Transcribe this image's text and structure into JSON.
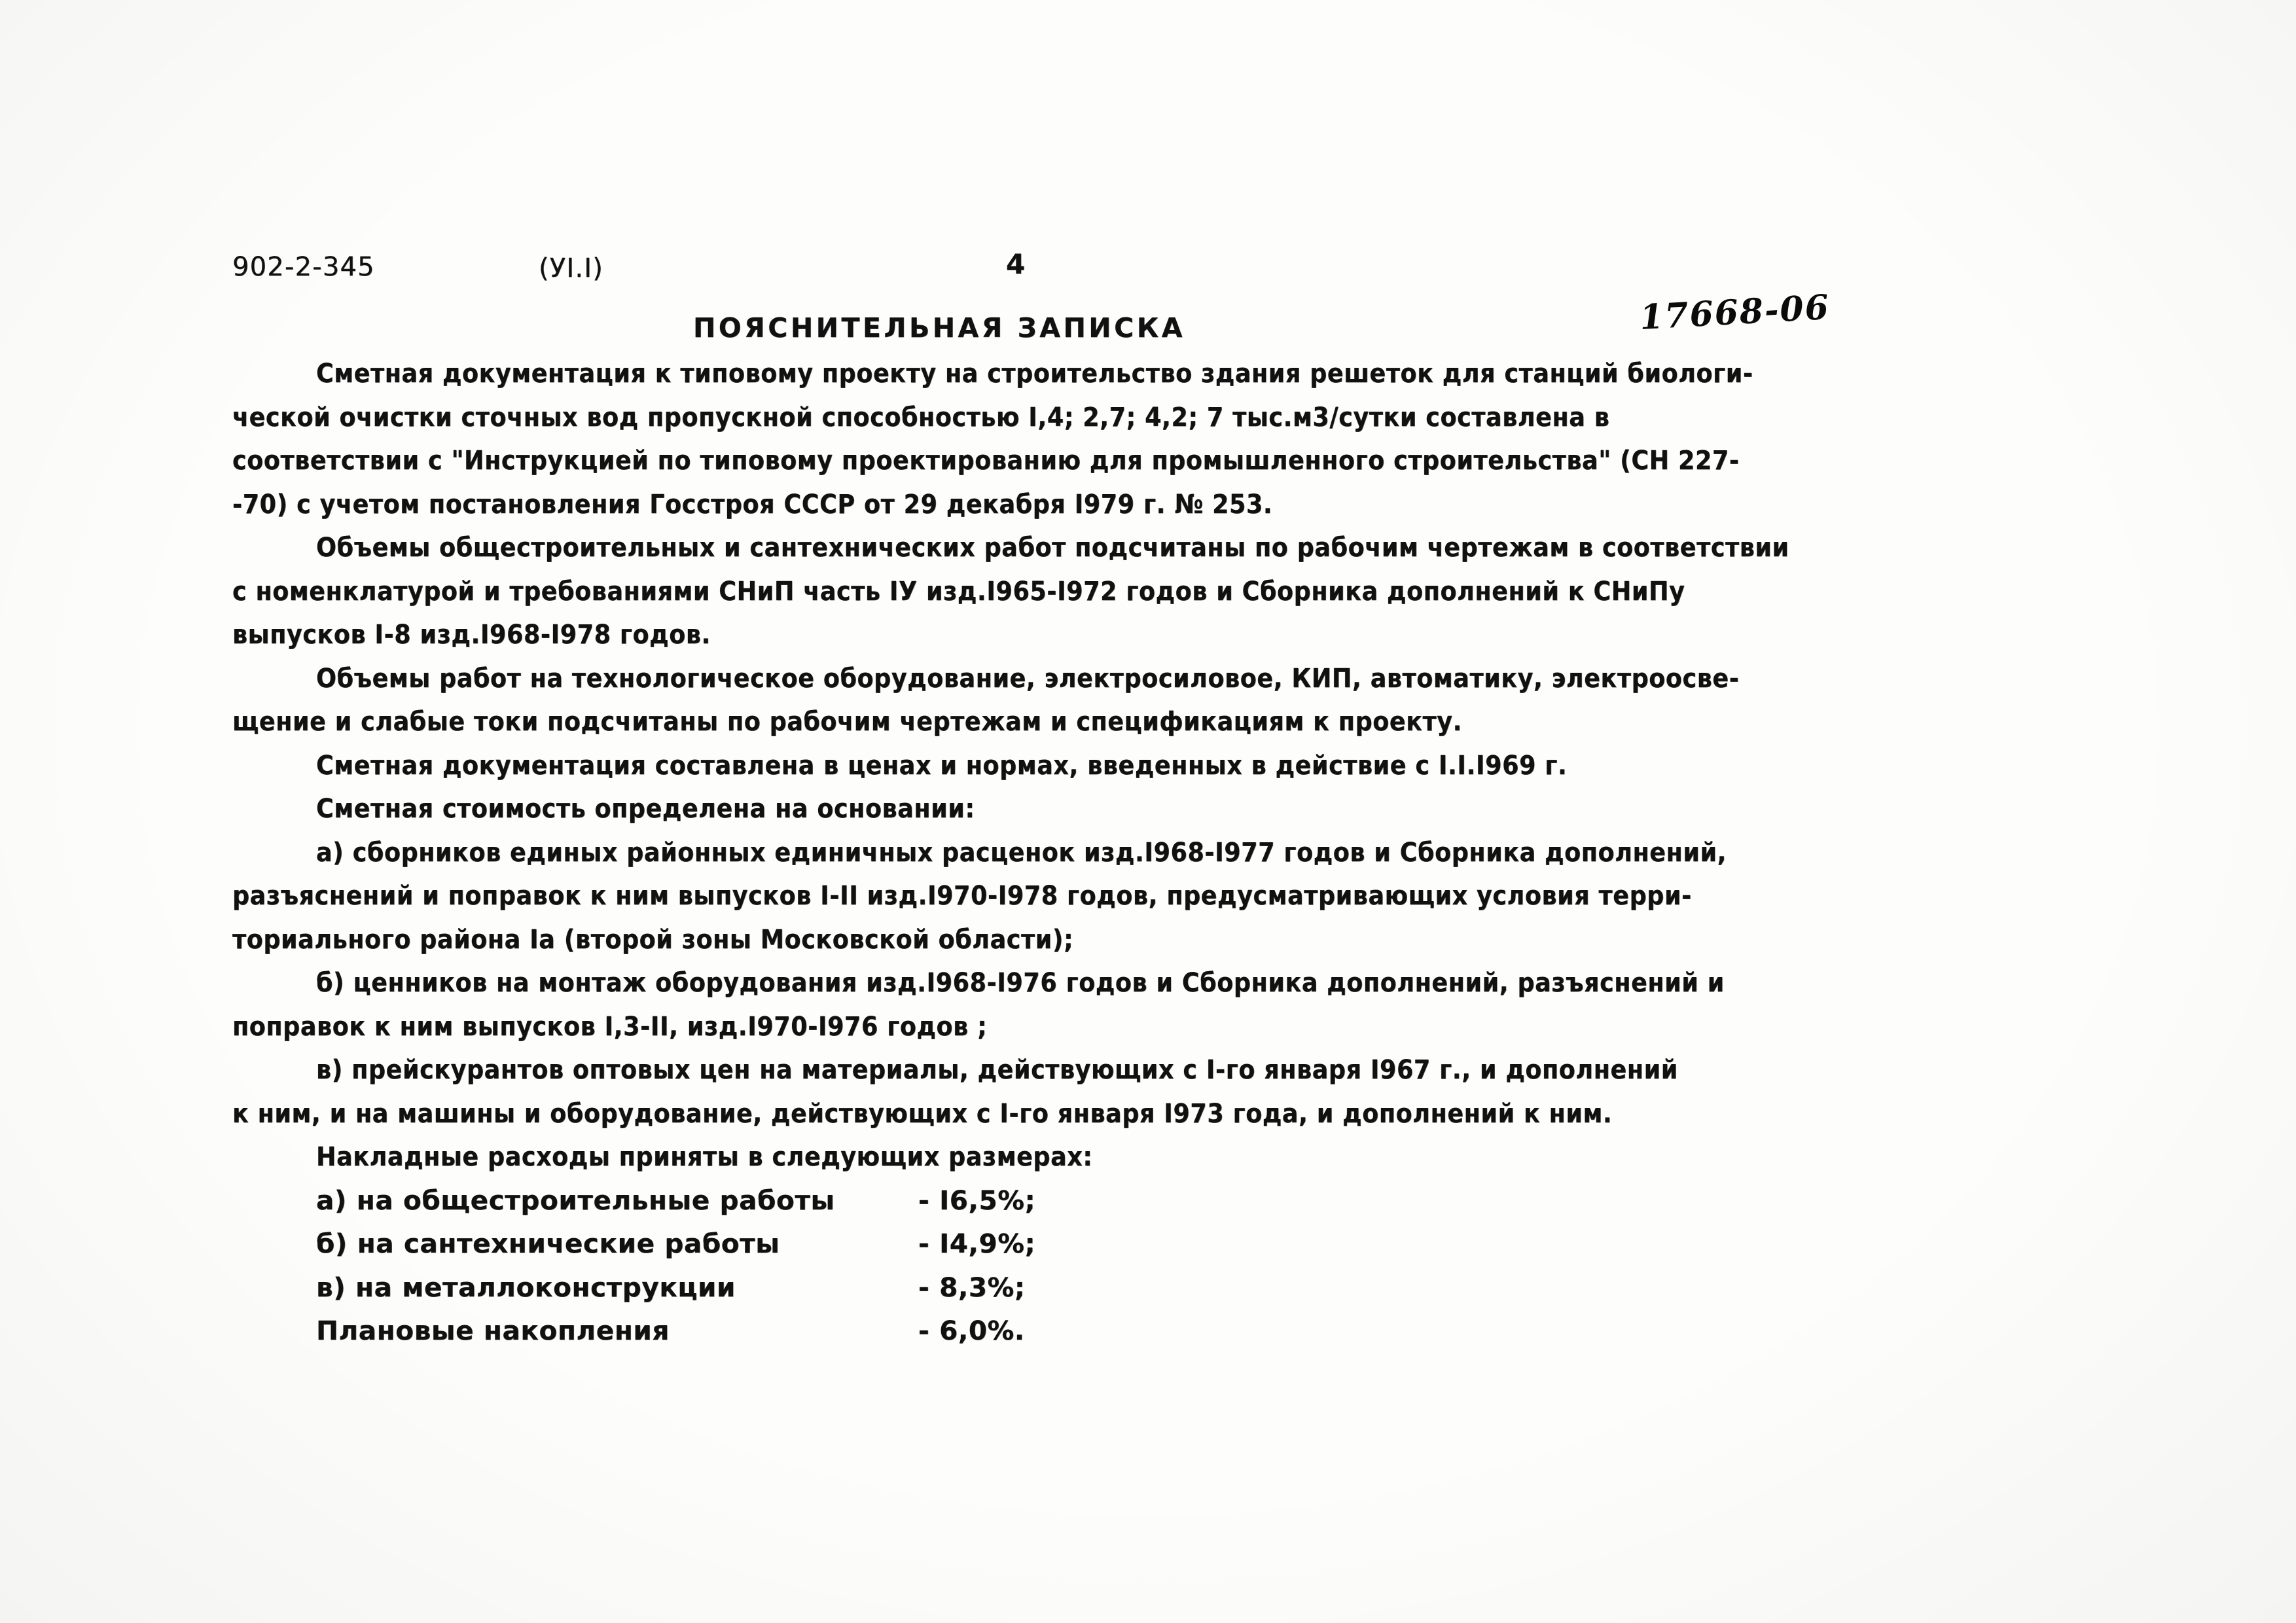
{
  "header": {
    "project_code": "902-2-345",
    "section_code": "(УI.I)",
    "page_number": "4",
    "title": "ПОЯСНИТЕЛЬНАЯ ЗАПИСКА",
    "archive_stamp": "17668-06"
  },
  "body": {
    "paragraph_1": [
      "Сметная документация к типовому проекту на строительство здания решеток для станций биологи-",
      "ческой очистки сточных вод пропускной способностью I,4; 2,7; 4,2; 7 тыс.м3/сутки составлена в",
      "соответствии с \"Инструкцией по типовому проектированию для промышленного строительства\" (СН 227-",
      "-70) с учетом постановления Госстроя СССР от 29 декабря I979 г. № 253."
    ],
    "paragraph_2": [
      "Объемы общестроительных и сантехнических работ подсчитаны по рабочим чертежам в соответствии",
      "с номенклатурой и требованиями СНиП часть IУ изд.I965-I972 годов и Сборника дополнений к СНиПу",
      "выпусков I-8 изд.I968-I978 годов."
    ],
    "paragraph_3": [
      "Объемы работ на технологическое оборудование, электросиловое, КИП, автоматику, электроосве-",
      "щение и слабые токи подсчитаны по рабочим чертежам и спецификациям к проекту."
    ],
    "paragraph_4": [
      "Сметная документация составлена в ценах и нормах, введенных в действие с I.I.I969 г."
    ],
    "paragraph_5": [
      "Сметная стоимость определена на основании:"
    ],
    "item_a": [
      "а) сборников единых районных единичных расценок изд.I968-I977 годов и Сборника дополнений,",
      "разъяснений и поправок к ним выпусков I-II изд.I970-I978 годов, предусматривающих условия терри-",
      "ториального района Iа (второй зоны Московской области);"
    ],
    "item_b": [
      "б) ценников на монтаж оборудования изд.I968-I976 годов и Сборника дополнений, разъяснений и",
      "поправок к ним выпусков I,3-II, изд.I970-I976 годов ;"
    ],
    "item_v": [
      "в) прейскурантов оптовых цен на материалы, действующих с I-го января I967 г., и дополнений",
      "к ним, и на машины и оборудование, действующих с I-го января I973 года, и дополнений к ним."
    ],
    "overheads_intro": "Накладные расходы приняты в следующих размерах:",
    "overheads": [
      {
        "label": "а) на общестроительные работы",
        "value": "- I6,5%;"
      },
      {
        "label": "б) на сантехнические работы",
        "value": "- I4,9%;"
      },
      {
        "label": "в) на металлоконструкции",
        "value": "- 8,3%;"
      },
      {
        "label": "Плановые накопления",
        "value": "- 6,0%."
      }
    ]
  }
}
